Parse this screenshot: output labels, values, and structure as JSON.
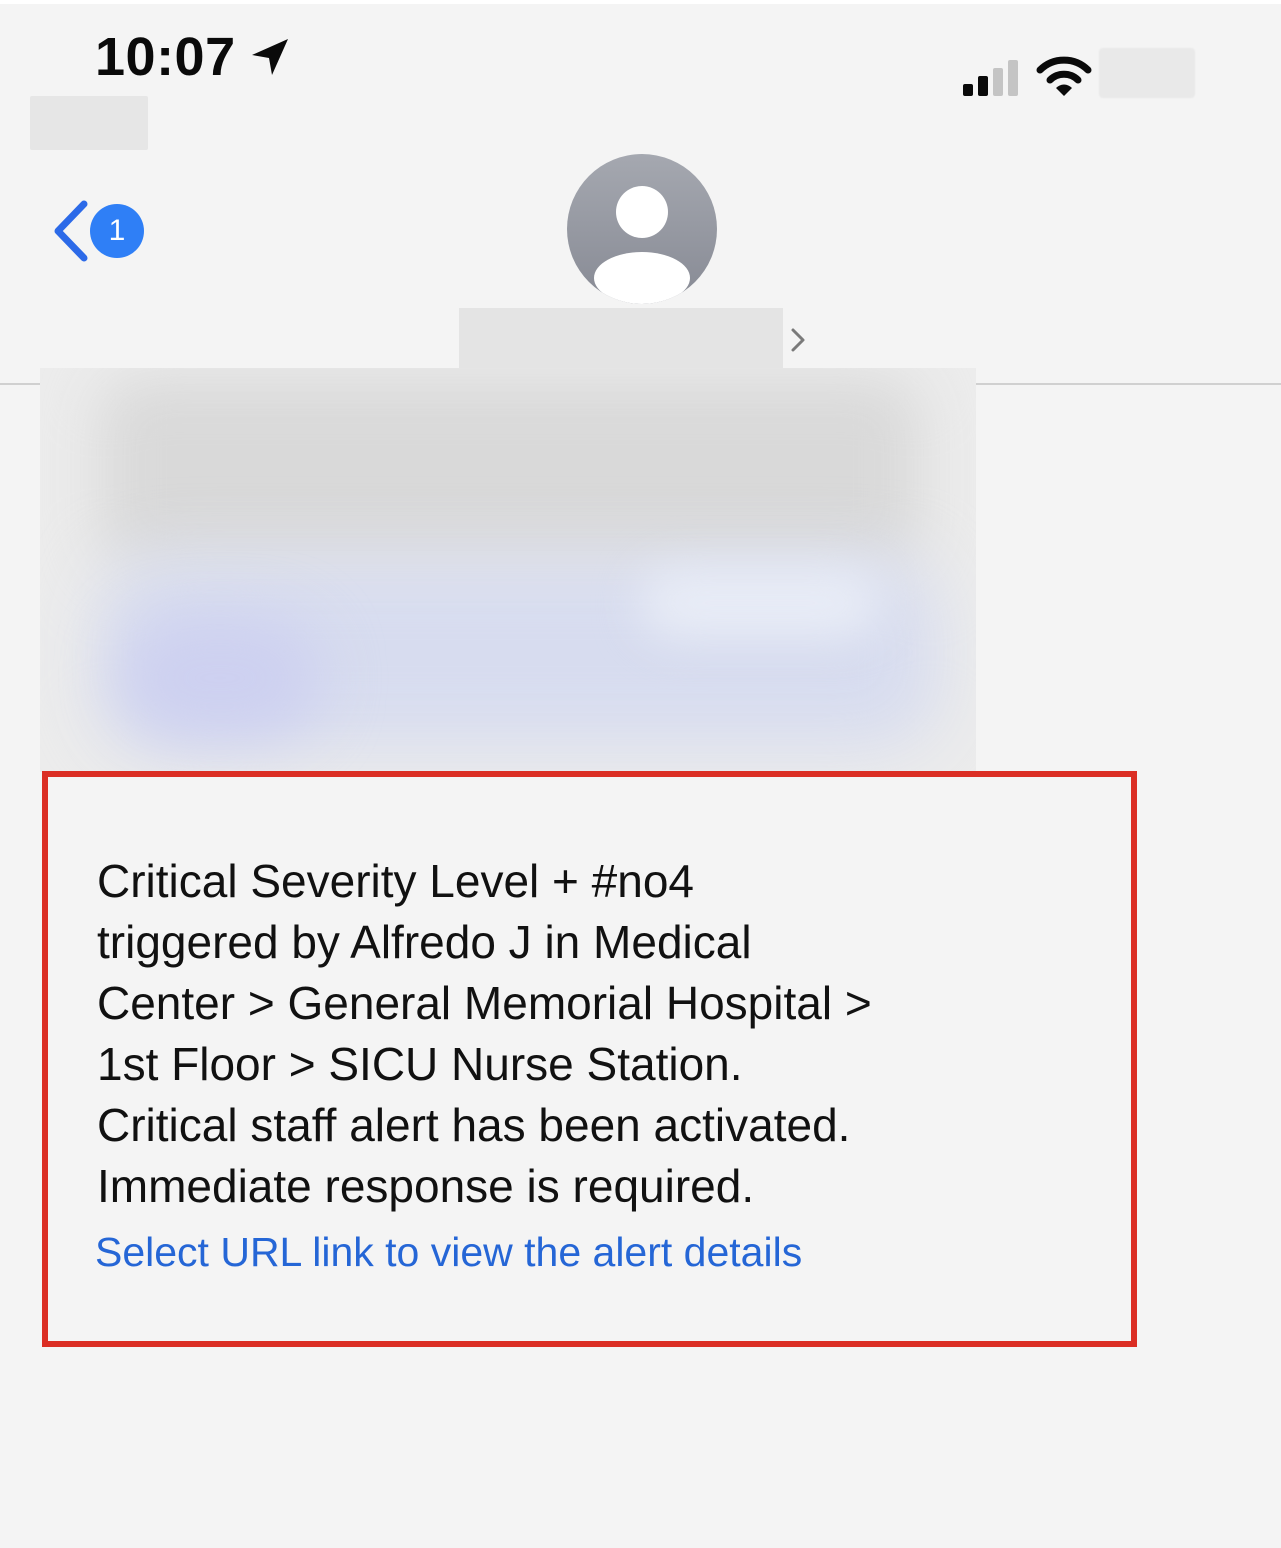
{
  "status_bar": {
    "time": "10:07",
    "location_icon": "location-arrow-icon",
    "signal_icon": "cellular-signal-icon",
    "wifi_icon": "wifi-icon"
  },
  "nav": {
    "back_icon": "chevron-left-icon",
    "unread_count": "1",
    "avatar_icon": "person-icon",
    "name_chevron_icon": "chevron-right-icon"
  },
  "message": {
    "lines": [
      "Critical Severity Level + #no4",
      "triggered by Alfredo J in Medical",
      "Center > General Memorial Hospital >",
      "1st Floor > SICU Nurse Station.",
      "Critical staff alert has been activated.",
      "Immediate response is required."
    ],
    "link_text": "Select URL link to view the alert details"
  },
  "colors": {
    "accent_blue": "#2f7ff6",
    "link_blue": "#2566d6",
    "highlight_red": "#db2e24",
    "background": "#f4f4f4"
  }
}
